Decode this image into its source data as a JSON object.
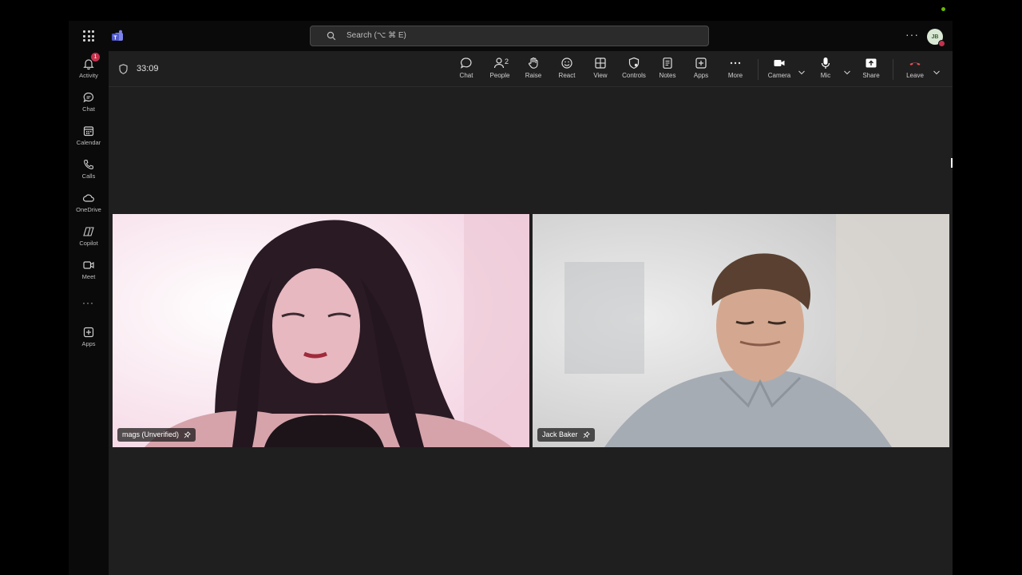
{
  "topbar": {
    "search_placeholder": "Search (⌥ ⌘ E)",
    "avatar_initials": "JB"
  },
  "rail": {
    "items": [
      {
        "label": "Activity",
        "icon": "bell-icon",
        "badge": "1"
      },
      {
        "label": "Chat",
        "icon": "chat-icon"
      },
      {
        "label": "Calendar",
        "icon": "calendar-icon"
      },
      {
        "label": "Calls",
        "icon": "phone-icon"
      },
      {
        "label": "OneDrive",
        "icon": "cloud-icon"
      },
      {
        "label": "Copilot",
        "icon": "copilot-icon"
      },
      {
        "label": "Meet",
        "icon": "video-icon"
      },
      {
        "label": "Apps",
        "icon": "add-app-icon"
      }
    ]
  },
  "meeting": {
    "timer": "33:09",
    "toolbar": {
      "chat": "Chat",
      "people": "People",
      "people_count": "2",
      "raise": "Raise",
      "react": "React",
      "view": "View",
      "controls": "Controls",
      "notes": "Notes",
      "apps": "Apps",
      "more": "More",
      "camera": "Camera",
      "mic": "Mic",
      "share": "Share",
      "leave": "Leave"
    },
    "participants": [
      {
        "name": "mags (Unverified)"
      },
      {
        "name": "Jack Baker"
      }
    ]
  },
  "colors": {
    "leave_red": "#e0525a",
    "badge_red": "#c4314b",
    "presence_green": "#6bb700"
  }
}
